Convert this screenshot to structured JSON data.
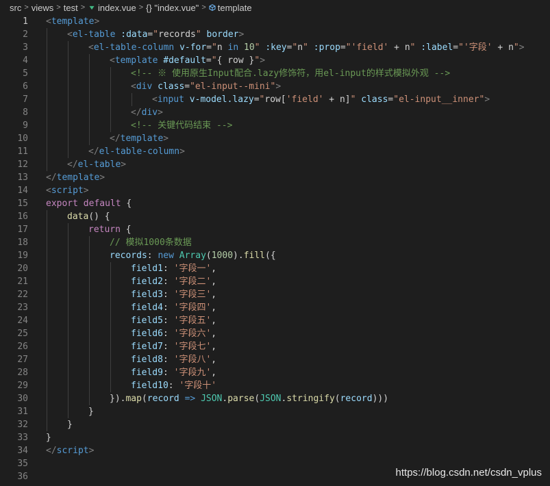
{
  "breadcrumb": {
    "items": [
      "src",
      "views",
      "test",
      "index.vue",
      "{} \"index.vue\"",
      "template"
    ],
    "separator": ">"
  },
  "editor": {
    "lines": [
      {
        "n": "1",
        "indent": 0,
        "tokens": [
          [
            "t-punc",
            "<"
          ],
          [
            "t-tag",
            "template"
          ],
          [
            "t-punc",
            ">"
          ]
        ]
      },
      {
        "n": "2",
        "indent": 1,
        "tokens": [
          [
            "t-punc",
            "<"
          ],
          [
            "t-tag",
            "el-table"
          ],
          [
            "t-txt",
            " "
          ],
          [
            "t-attr",
            ":data"
          ],
          [
            "t-txt",
            "="
          ],
          [
            "t-str",
            "\""
          ],
          [
            "t-txt",
            "records"
          ],
          [
            "t-str",
            "\""
          ],
          [
            "t-txt",
            " "
          ],
          [
            "t-attr",
            "border"
          ],
          [
            "t-punc",
            ">"
          ]
        ]
      },
      {
        "n": "3",
        "indent": 2,
        "tokens": [
          [
            "t-punc",
            "<"
          ],
          [
            "t-tag",
            "el-table-column"
          ],
          [
            "t-txt",
            " "
          ],
          [
            "t-attr",
            "v-for"
          ],
          [
            "t-txt",
            "="
          ],
          [
            "t-str",
            "\""
          ],
          [
            "t-txt",
            "n "
          ],
          [
            "t-blue",
            "in"
          ],
          [
            "t-txt",
            " "
          ],
          [
            "t-num",
            "10"
          ],
          [
            "t-str",
            "\""
          ],
          [
            "t-txt",
            " "
          ],
          [
            "t-attr",
            ":key"
          ],
          [
            "t-txt",
            "="
          ],
          [
            "t-str",
            "\""
          ],
          [
            "t-txt",
            "n"
          ],
          [
            "t-str",
            "\""
          ],
          [
            "t-txt",
            " "
          ],
          [
            "t-attr",
            ":prop"
          ],
          [
            "t-txt",
            "="
          ],
          [
            "t-str",
            "\""
          ],
          [
            "t-str",
            "'field'"
          ],
          [
            "t-txt",
            " + n"
          ],
          [
            "t-str",
            "\""
          ],
          [
            "t-txt",
            " "
          ],
          [
            "t-attr",
            ":label"
          ],
          [
            "t-txt",
            "="
          ],
          [
            "t-str",
            "\""
          ],
          [
            "t-str",
            "'字段'"
          ],
          [
            "t-txt",
            " + n"
          ],
          [
            "t-str",
            "\""
          ],
          [
            "t-punc",
            ">"
          ]
        ]
      },
      {
        "n": "4",
        "indent": 3,
        "tokens": [
          [
            "t-punc",
            "<"
          ],
          [
            "t-tag",
            "template"
          ],
          [
            "t-txt",
            " "
          ],
          [
            "t-attr",
            "#default"
          ],
          [
            "t-txt",
            "="
          ],
          [
            "t-str",
            "\""
          ],
          [
            "t-txt",
            "{ row }"
          ],
          [
            "t-str",
            "\""
          ],
          [
            "t-punc",
            ">"
          ]
        ]
      },
      {
        "n": "5",
        "indent": 4,
        "tokens": [
          [
            "t-com",
            "<!-- ※ 使用原生Input配合.lazy修饰符，用el-input的样式模拟外观 -->"
          ]
        ]
      },
      {
        "n": "6",
        "indent": 4,
        "tokens": [
          [
            "t-punc",
            "<"
          ],
          [
            "t-tag",
            "div"
          ],
          [
            "t-txt",
            " "
          ],
          [
            "t-attr",
            "class"
          ],
          [
            "t-txt",
            "="
          ],
          [
            "t-str",
            "\"el-input--mini\""
          ],
          [
            "t-punc",
            ">"
          ]
        ]
      },
      {
        "n": "7",
        "indent": 5,
        "tokens": [
          [
            "t-punc",
            "<"
          ],
          [
            "t-tag",
            "input"
          ],
          [
            "t-txt",
            " "
          ],
          [
            "t-attr",
            "v-model.lazy"
          ],
          [
            "t-txt",
            "="
          ],
          [
            "t-str",
            "\""
          ],
          [
            "t-txt",
            "row["
          ],
          [
            "t-str",
            "'field'"
          ],
          [
            "t-txt",
            " + n]"
          ],
          [
            "t-str",
            "\""
          ],
          [
            "t-txt",
            " "
          ],
          [
            "t-attr",
            "class"
          ],
          [
            "t-txt",
            "="
          ],
          [
            "t-str",
            "\"el-input__inner\""
          ],
          [
            "t-punc",
            ">"
          ]
        ]
      },
      {
        "n": "8",
        "indent": 4,
        "tokens": [
          [
            "t-punc",
            "</"
          ],
          [
            "t-tag",
            "div"
          ],
          [
            "t-punc",
            ">"
          ]
        ]
      },
      {
        "n": "9",
        "indent": 4,
        "tokens": [
          [
            "t-com",
            "<!-- 关键代码结束 -->"
          ]
        ]
      },
      {
        "n": "10",
        "indent": 3,
        "tokens": [
          [
            "t-punc",
            "</"
          ],
          [
            "t-tag",
            "template"
          ],
          [
            "t-punc",
            ">"
          ]
        ]
      },
      {
        "n": "11",
        "indent": 2,
        "tokens": [
          [
            "t-punc",
            "</"
          ],
          [
            "t-tag",
            "el-table-column"
          ],
          [
            "t-punc",
            ">"
          ]
        ]
      },
      {
        "n": "12",
        "indent": 1,
        "tokens": [
          [
            "t-punc",
            "</"
          ],
          [
            "t-tag",
            "el-table"
          ],
          [
            "t-punc",
            ">"
          ]
        ]
      },
      {
        "n": "13",
        "indent": 0,
        "tokens": [
          [
            "t-punc",
            "</"
          ],
          [
            "t-tag",
            "template"
          ],
          [
            "t-punc",
            ">"
          ]
        ]
      },
      {
        "n": "14",
        "indent": 0,
        "tokens": [
          [
            "t-punc",
            "<"
          ],
          [
            "t-tag",
            "script"
          ],
          [
            "t-punc",
            ">"
          ]
        ]
      },
      {
        "n": "15",
        "indent": 0,
        "tokens": [
          [
            "t-kw",
            "export"
          ],
          [
            "t-txt",
            " "
          ],
          [
            "t-kw",
            "default"
          ],
          [
            "t-txt",
            " {"
          ]
        ]
      },
      {
        "n": "16",
        "indent": 1,
        "tokens": [
          [
            "t-fn",
            "data"
          ],
          [
            "t-txt",
            "() {"
          ]
        ]
      },
      {
        "n": "17",
        "indent": 2,
        "tokens": [
          [
            "t-kw",
            "return"
          ],
          [
            "t-txt",
            " {"
          ]
        ]
      },
      {
        "n": "18",
        "indent": 3,
        "tokens": [
          [
            "t-com",
            "// 模拟1000条数据"
          ]
        ]
      },
      {
        "n": "19",
        "indent": 3,
        "tokens": [
          [
            "t-var",
            "records"
          ],
          [
            "t-txt",
            ": "
          ],
          [
            "t-blue",
            "new"
          ],
          [
            "t-txt",
            " "
          ],
          [
            "t-cls",
            "Array"
          ],
          [
            "t-txt",
            "("
          ],
          [
            "t-num",
            "1000"
          ],
          [
            "t-txt",
            ")."
          ],
          [
            "t-fn",
            "fill"
          ],
          [
            "t-txt",
            "({"
          ]
        ]
      },
      {
        "n": "20",
        "indent": 4,
        "tokens": [
          [
            "t-var",
            "field1"
          ],
          [
            "t-txt",
            ": "
          ],
          [
            "t-str",
            "'字段一'"
          ],
          [
            "t-txt",
            ","
          ]
        ]
      },
      {
        "n": "21",
        "indent": 4,
        "tokens": [
          [
            "t-var",
            "field2"
          ],
          [
            "t-txt",
            ": "
          ],
          [
            "t-str",
            "'字段二'"
          ],
          [
            "t-txt",
            ","
          ]
        ]
      },
      {
        "n": "22",
        "indent": 4,
        "tokens": [
          [
            "t-var",
            "field3"
          ],
          [
            "t-txt",
            ": "
          ],
          [
            "t-str",
            "'字段三'"
          ],
          [
            "t-txt",
            ","
          ]
        ]
      },
      {
        "n": "23",
        "indent": 4,
        "tokens": [
          [
            "t-var",
            "field4"
          ],
          [
            "t-txt",
            ": "
          ],
          [
            "t-str",
            "'字段四'"
          ],
          [
            "t-txt",
            ","
          ]
        ]
      },
      {
        "n": "24",
        "indent": 4,
        "tokens": [
          [
            "t-var",
            "field5"
          ],
          [
            "t-txt",
            ": "
          ],
          [
            "t-str",
            "'字段五'"
          ],
          [
            "t-txt",
            ","
          ]
        ]
      },
      {
        "n": "25",
        "indent": 4,
        "tokens": [
          [
            "t-var",
            "field6"
          ],
          [
            "t-txt",
            ": "
          ],
          [
            "t-str",
            "'字段六'"
          ],
          [
            "t-txt",
            ","
          ]
        ]
      },
      {
        "n": "26",
        "indent": 4,
        "tokens": [
          [
            "t-var",
            "field7"
          ],
          [
            "t-txt",
            ": "
          ],
          [
            "t-str",
            "'字段七'"
          ],
          [
            "t-txt",
            ","
          ]
        ]
      },
      {
        "n": "27",
        "indent": 4,
        "tokens": [
          [
            "t-var",
            "field8"
          ],
          [
            "t-txt",
            ": "
          ],
          [
            "t-str",
            "'字段八'"
          ],
          [
            "t-txt",
            ","
          ]
        ]
      },
      {
        "n": "28",
        "indent": 4,
        "tokens": [
          [
            "t-var",
            "field9"
          ],
          [
            "t-txt",
            ": "
          ],
          [
            "t-str",
            "'字段九'"
          ],
          [
            "t-txt",
            ","
          ]
        ]
      },
      {
        "n": "29",
        "indent": 4,
        "tokens": [
          [
            "t-var",
            "field10"
          ],
          [
            "t-txt",
            ": "
          ],
          [
            "t-str",
            "'字段十'"
          ]
        ]
      },
      {
        "n": "30",
        "indent": 3,
        "tokens": [
          [
            "t-txt",
            "})."
          ],
          [
            "t-fn",
            "map"
          ],
          [
            "t-txt",
            "("
          ],
          [
            "t-var",
            "record"
          ],
          [
            "t-txt",
            " "
          ],
          [
            "t-blue",
            "=>"
          ],
          [
            "t-txt",
            " "
          ],
          [
            "t-cls",
            "JSON"
          ],
          [
            "t-txt",
            "."
          ],
          [
            "t-fn",
            "parse"
          ],
          [
            "t-txt",
            "("
          ],
          [
            "t-cls",
            "JSON"
          ],
          [
            "t-txt",
            "."
          ],
          [
            "t-fn",
            "stringify"
          ],
          [
            "t-txt",
            "("
          ],
          [
            "t-var",
            "record"
          ],
          [
            "t-txt",
            ")))"
          ]
        ]
      },
      {
        "n": "31",
        "indent": 2,
        "tokens": [
          [
            "t-txt",
            "}"
          ]
        ]
      },
      {
        "n": "32",
        "indent": 1,
        "tokens": [
          [
            "t-txt",
            "}"
          ]
        ]
      },
      {
        "n": "33",
        "indent": 0,
        "tokens": [
          [
            "t-txt",
            "}"
          ]
        ]
      },
      {
        "n": "34",
        "indent": 0,
        "tokens": [
          [
            "t-punc",
            "</"
          ],
          [
            "t-tag",
            "script"
          ],
          [
            "t-punc",
            ">"
          ]
        ]
      },
      {
        "n": "35",
        "indent": 0,
        "tokens": []
      },
      {
        "n": "36",
        "indent": 0,
        "tokens": []
      }
    ]
  },
  "watermark": "https://blog.csdn.net/csdn_vplus",
  "colors": {
    "background": "#1e1e1e",
    "tag": "#569cd6",
    "attribute": "#9cdcfe",
    "string": "#ce9178",
    "comment": "#6a9955",
    "keyword": "#c586c0",
    "function": "#dcdcaa",
    "class": "#4ec9b0",
    "number": "#b5cea8"
  },
  "icons": {
    "vue_file": "vue-icon",
    "braces": "braces-icon",
    "template_node": "cube-icon"
  }
}
